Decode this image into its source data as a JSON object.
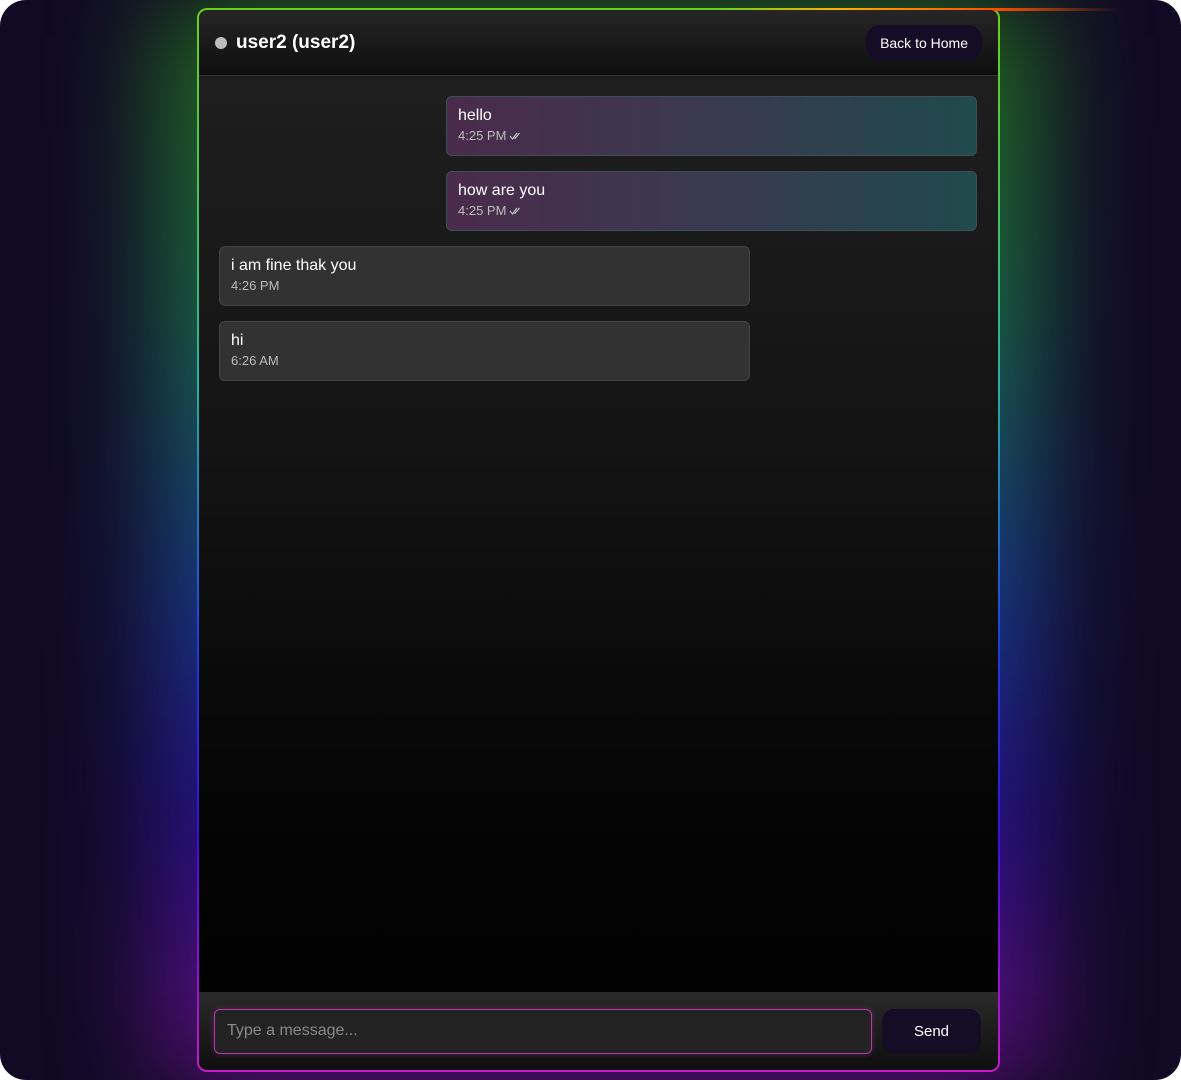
{
  "header": {
    "title": "user2 (user2)",
    "back_label": "Back to Home"
  },
  "messages": [
    {
      "text": "hello",
      "time": "4:25 PM",
      "direction": "sent",
      "status_icon": "double-check-icon"
    },
    {
      "text": "how are you",
      "time": "4:25 PM",
      "direction": "sent",
      "status_icon": "double-check-icon"
    },
    {
      "text": "i am fine thak you",
      "time": "4:26 PM",
      "direction": "received"
    },
    {
      "text": "hi",
      "time": "6:26 AM",
      "direction": "received"
    }
  ],
  "composer": {
    "placeholder": "Type a message...",
    "value": "",
    "send_label": "Send"
  },
  "colors": {
    "page_background": "#110a24",
    "button_background": "#150d26",
    "input_border": "#b23aa8",
    "status_dot": "#bdbdbd"
  }
}
